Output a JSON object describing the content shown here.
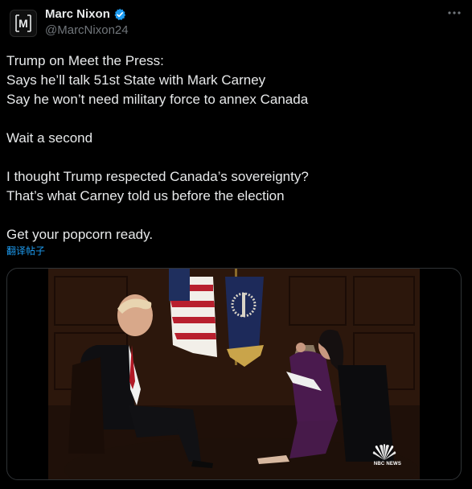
{
  "author": {
    "display_name": "Marc Nixon",
    "handle": "@MarcNixon24",
    "avatar_letter": "M",
    "verified": true,
    "verified_color": "#1d9bf0"
  },
  "tweet": {
    "lines": [
      "Trump on Meet the Press:",
      "Says he’ll talk 51st State with Mark Carney",
      "Say he won’t need military force to annex Canada",
      "",
      "Wait a second",
      "",
      "I thought Trump respected Canada’s sovereignty?",
      "That’s what Carney told us before the election",
      "",
      "Get your popcorn ready."
    ],
    "translate_label": "翻译帖子"
  },
  "media": {
    "type": "video",
    "watermark": "NBC NEWS"
  },
  "icons": {
    "more": "more-horizontal-icon",
    "verified": "verified-badge-icon",
    "avatar": "logo-m-icon",
    "watermark": "nbc-peacock-icon"
  },
  "colors": {
    "background": "#000000",
    "text": "#e7e9ea",
    "secondary_text": "#71767b",
    "link": "#1d9bf0",
    "border": "#2f3336"
  }
}
